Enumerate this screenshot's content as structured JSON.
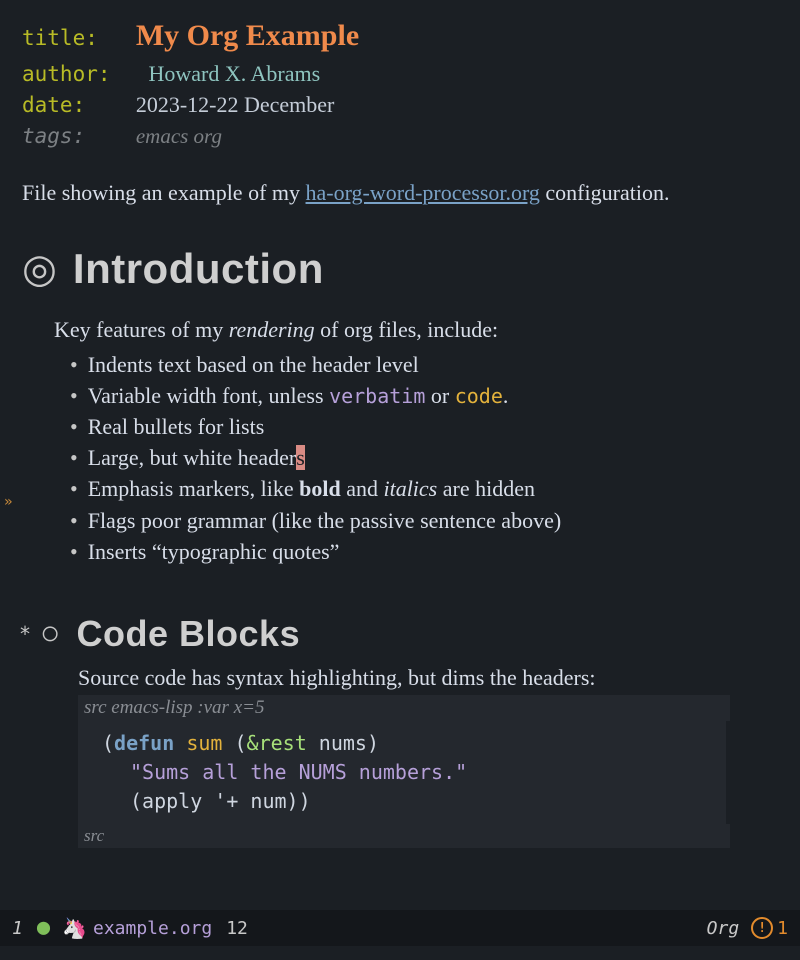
{
  "meta": {
    "title_key": "title:",
    "title_val": "My Org Example",
    "author_key": "author:",
    "author_val": "Howard X. Abrams",
    "date_key": "date:",
    "date_val": "2023-12-22 December",
    "tags_key": "tags:",
    "tags_val": "emacs org"
  },
  "intro": {
    "prefix": "File showing an example of my ",
    "link_text": "ha-org-word-processor.org",
    "suffix": " configuration."
  },
  "h1": {
    "bullet": "◎",
    "text": "Introduction"
  },
  "features": {
    "lead_pre": "Key features of my ",
    "lead_em": "rendering",
    "lead_post": " of org files, include:",
    "items": [
      {
        "text": "Indents text based on the header level"
      },
      {
        "pre": "Variable width font, unless ",
        "verbatim": "verbatim",
        "mid": " or ",
        "code": "code",
        "post": "."
      },
      {
        "text": "Real bullets for lists"
      },
      {
        "pre": "Large, but white header",
        "cursor": "s"
      },
      {
        "pre": "Emphasis markers, like ",
        "bold": "bold",
        "mid": " and ",
        "italic": "italics",
        "post": " are hidden"
      },
      {
        "text": "Flags poor grammar (like the passive sentence above)"
      },
      {
        "text": "Inserts “typographic quotes”"
      }
    ]
  },
  "h2": {
    "star": "*",
    "bullet": "○",
    "text": "Code Blocks"
  },
  "code_section": {
    "lead": "Source code has syntax highlighting, but dims the headers:",
    "header_pre": "src ",
    "header_main": "emacs-lisp :var x=5",
    "lines": {
      "l1_open": "(",
      "l1_defun": "defun",
      "l1_sp": " ",
      "l1_name": "sum",
      "l1_sp2": " (",
      "l1_amp": "&rest",
      "l1_rest": " nums)",
      "l2": "\"Sums all the NUMS numbers.\"",
      "l3_open": "(apply ",
      "l3_q": "'+",
      "l3_rest": " num))"
    },
    "footer": "src"
  },
  "modeline": {
    "window": "1",
    "filename": "example.org",
    "line": "12",
    "mode": "Org",
    "warn_count": "1"
  },
  "fringe": "»"
}
